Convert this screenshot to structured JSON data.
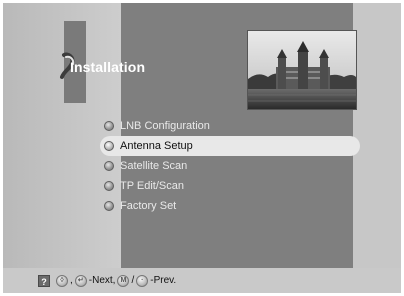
{
  "menu": {
    "title": "Installation",
    "items": [
      {
        "label": "LNB Configuration"
      },
      {
        "label": "Antenna Setup"
      },
      {
        "label": "Satellite Scan"
      },
      {
        "label": "TP Edit/Scan"
      },
      {
        "label": "Factory Set"
      }
    ],
    "selected_index": 1
  },
  "hints": {
    "help_key": "?",
    "sep1": ",",
    "next_label": "-Next,",
    "slash": "/",
    "prev_label": "-Prev.",
    "key_icons": [
      "up-down-key-icon",
      "ok-key-icon",
      "menu-key-icon",
      "exit-key-icon"
    ]
  },
  "colors": {
    "selected_background": "#e8e8e8",
    "menu_text": "#e9e9e9",
    "selected_text": "#111111",
    "panel": "#7f7f7f"
  }
}
